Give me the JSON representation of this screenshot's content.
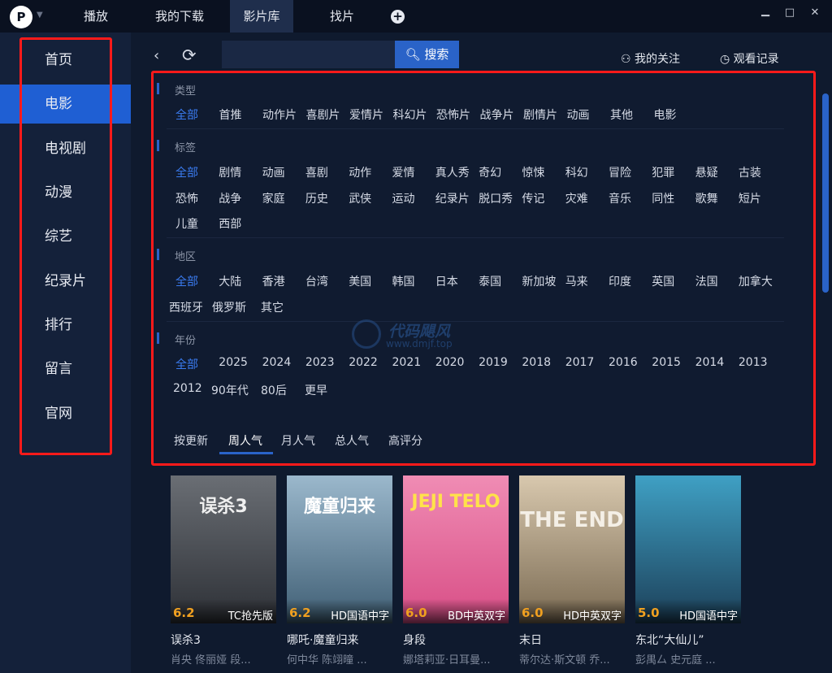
{
  "app": {
    "logo_text": "P"
  },
  "tabs": [
    {
      "label": "播放"
    },
    {
      "label": "我的下载"
    },
    {
      "label": "影片库"
    },
    {
      "label": "找片"
    }
  ],
  "window": {
    "minimize": "▁",
    "maximize": "□",
    "close": "✕"
  },
  "sidebar": {
    "items": [
      {
        "label": "首页"
      },
      {
        "label": "电影"
      },
      {
        "label": "电视剧"
      },
      {
        "label": "动漫"
      },
      {
        "label": "综艺"
      },
      {
        "label": "纪录片"
      },
      {
        "label": "排行"
      },
      {
        "label": "留言"
      },
      {
        "label": "官网"
      }
    ]
  },
  "toolbar": {
    "search_placeholder": "",
    "search_label": "搜索",
    "follow_label": "我的关注",
    "history_label": "观看记录"
  },
  "filters": {
    "type": {
      "title": "类型",
      "options": [
        "全部",
        "首推",
        "动作片",
        "喜剧片",
        "爱情片",
        "科幻片",
        "恐怖片",
        "战争片",
        "剧情片",
        "动画",
        "其他",
        "电影"
      ]
    },
    "tag": {
      "title": "标签",
      "options": [
        "全部",
        "剧情",
        "动画",
        "喜剧",
        "动作",
        "爱情",
        "真人秀",
        "奇幻",
        "惊悚",
        "科幻",
        "冒险",
        "犯罪",
        "悬疑",
        "古装",
        "恐怖",
        "战争",
        "家庭",
        "历史",
        "武侠",
        "运动",
        "纪录片",
        "脱口秀",
        "传记",
        "灾难",
        "音乐",
        "同性",
        "歌舞",
        "短片",
        "儿童",
        "西部"
      ]
    },
    "region": {
      "title": "地区",
      "options": [
        "全部",
        "大陆",
        "香港",
        "台湾",
        "美国",
        "韩国",
        "日本",
        "泰国",
        "新加坡",
        "马来",
        "印度",
        "英国",
        "法国",
        "加拿大",
        "西班牙",
        "俄罗斯",
        "其它"
      ]
    },
    "year": {
      "title": "年份",
      "options": [
        "全部",
        "2025",
        "2024",
        "2023",
        "2022",
        "2021",
        "2020",
        "2019",
        "2018",
        "2017",
        "2016",
        "2015",
        "2014",
        "2013",
        "2012",
        "90年代",
        "80后",
        "更早"
      ]
    }
  },
  "sort": {
    "options": [
      "按更新",
      "周人气",
      "月人气",
      "总人气",
      "高评分"
    ]
  },
  "watermark": {
    "title": "代码飓风",
    "url": "www.dmjf.top"
  },
  "movies": [
    {
      "title": "误杀3",
      "cast": "肖央 佟丽娅 段...",
      "rating": "6.2",
      "quality": "TC抢先版",
      "poster_text": "误杀3",
      "bg": "#3a3f46"
    },
    {
      "title": "哪吒·魔童归来",
      "cast": "何中华 陈翊曈 ...",
      "rating": "6.2",
      "quality": "HD国语中字",
      "poster_text": "魔童归来",
      "bg": "#6b8fa8"
    },
    {
      "title": "身段",
      "cast": "娜塔莉亚·日耳曼...",
      "rating": "6.0",
      "quality": "BD中英双字",
      "poster_text": "JEJI TELO",
      "bg": "#e8609a"
    },
    {
      "title": "末日",
      "cast": "蒂尔达·斯文顿 乔...",
      "rating": "6.0",
      "quality": "HD中英双字",
      "poster_text": "THE END",
      "bg": "#a89478"
    },
    {
      "title": "东北“大仙儿”",
      "cast": "彭禺厶 史元庭 ...",
      "rating": "5.0",
      "quality": "HD国语中字",
      "poster_text": "",
      "bg": "#2a6e8c"
    }
  ]
}
